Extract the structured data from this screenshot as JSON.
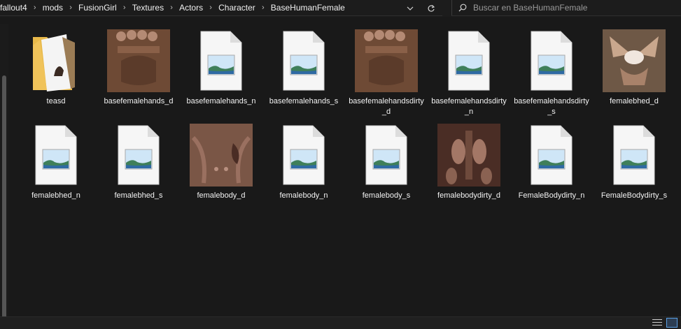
{
  "breadcrumb": [
    "fallout4",
    "mods",
    "FusionGirl",
    "Textures",
    "Actors",
    "Character",
    "BaseHumanFemale"
  ],
  "search": {
    "placeholder": "Buscar en BaseHumanFemale"
  },
  "icons": {
    "dropdown": "chevron-down-icon",
    "refresh": "refresh-icon",
    "search": "search-icon"
  },
  "files": [
    {
      "name": "teasd",
      "icon": "folder-icon"
    },
    {
      "name": "basefemalehands_d",
      "icon": "texture-thumbnail-hands"
    },
    {
      "name": "basefemalehands_n",
      "icon": "image-file-icon"
    },
    {
      "name": "basefemalehands_s",
      "icon": "image-file-icon"
    },
    {
      "name": "basefemalehandsdirty_d",
      "icon": "texture-thumbnail-hands"
    },
    {
      "name": "basefemalehandsdirty_n",
      "icon": "image-file-icon"
    },
    {
      "name": "basefemalehandsdirty_s",
      "icon": "image-file-icon"
    },
    {
      "name": "femalebhed_d",
      "icon": "texture-thumbnail-head"
    },
    {
      "name": "femalebhed_n",
      "icon": "image-file-icon"
    },
    {
      "name": "femalebhed_s",
      "icon": "image-file-icon"
    },
    {
      "name": "femalebody_d",
      "icon": "texture-thumbnail-body"
    },
    {
      "name": "femalebody_n",
      "icon": "image-file-icon"
    },
    {
      "name": "femalebody_s",
      "icon": "image-file-icon"
    },
    {
      "name": "femalebodydirty_d",
      "icon": "texture-thumbnail-body-dirty"
    },
    {
      "name": "FemaleBodydirty_n",
      "icon": "image-file-icon"
    },
    {
      "name": "FemaleBodydirty_s",
      "icon": "image-file-icon"
    }
  ],
  "colors": {
    "background": "#191919",
    "text": "#ffffff",
    "accent": "#5aa0e6"
  }
}
